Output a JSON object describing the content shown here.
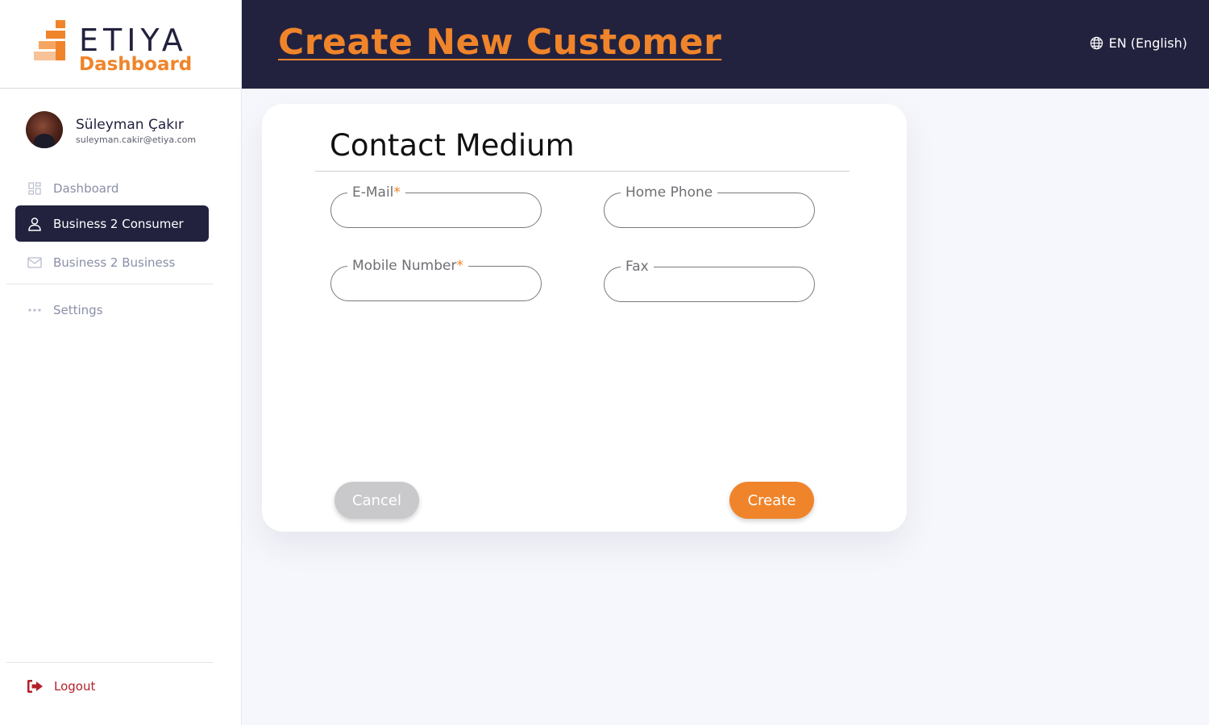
{
  "brand": {
    "name": "ETIYA",
    "product": "Dashboard",
    "accent": "#f0842a",
    "navy": "#22223f"
  },
  "user": {
    "name": "Süleyman Çakır",
    "email": "suleyman.cakir@etiya.com"
  },
  "sidebar": {
    "items": [
      {
        "label": "Dashboard",
        "icon": "grid-icon",
        "active": false
      },
      {
        "label": "Business 2 Consumer",
        "icon": "user-icon",
        "active": true
      },
      {
        "label": "Business 2 Business",
        "icon": "mail-icon",
        "active": false
      },
      {
        "label": "Settings",
        "icon": "dots-icon",
        "active": false
      }
    ],
    "logout_label": "Logout",
    "logout_icon": "logout-icon"
  },
  "header": {
    "title": "Create New Customer",
    "language": "EN (English)",
    "language_icon": "globe-icon"
  },
  "form": {
    "section_title": "Contact Medium",
    "fields": [
      {
        "label": "E-Mail",
        "required": true,
        "value": ""
      },
      {
        "label": "Home Phone",
        "required": false,
        "value": ""
      },
      {
        "label": "Mobile Number",
        "required": true,
        "value": ""
      },
      {
        "label": "Fax",
        "required": false,
        "value": ""
      }
    ],
    "required_marker": "*",
    "cancel_label": "Cancel",
    "create_label": "Create"
  }
}
